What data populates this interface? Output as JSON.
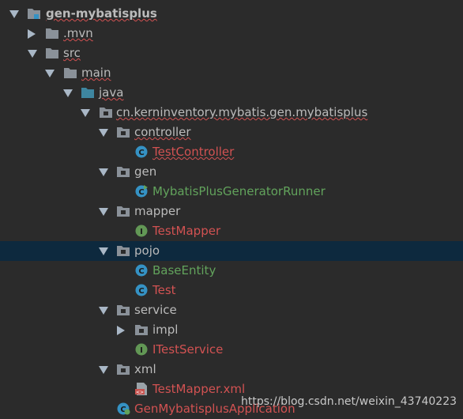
{
  "colors": {
    "background": "#2b2b2b",
    "selected_row": "#0d293e",
    "folder": "#8a9199",
    "source_folder": "#3e86a0",
    "class_icon": "#3592c4",
    "interface_icon": "#629755",
    "error_text": "#d25252",
    "modified_text": "#62a35c"
  },
  "tree": {
    "project": {
      "label": "gen-mybatisplus",
      "icon": "module-folder-icon"
    },
    "mvn": {
      "label": ".mvn",
      "icon": "folder-icon"
    },
    "src": {
      "label": "src",
      "icon": "folder-icon"
    },
    "main": {
      "label": "main",
      "icon": "folder-icon"
    },
    "java": {
      "label": "java",
      "icon": "source-root-icon"
    },
    "package": {
      "label": "cn.kerninventory.mybatis.gen.mybatisplus",
      "icon": "package-icon"
    },
    "controller": {
      "label": "controller",
      "icon": "package-icon"
    },
    "test_controller": {
      "label": "TestController",
      "icon": "class-icon"
    },
    "gen": {
      "label": "gen",
      "icon": "package-icon"
    },
    "runner": {
      "label": "MybatisPlusGeneratorRunner",
      "icon": "runnable-class-icon"
    },
    "mapper": {
      "label": "mapper",
      "icon": "package-icon"
    },
    "test_mapper": {
      "label": "TestMapper",
      "icon": "interface-icon"
    },
    "pojo": {
      "label": "pojo",
      "icon": "package-icon"
    },
    "base_entity": {
      "label": "BaseEntity",
      "icon": "class-icon"
    },
    "test": {
      "label": "Test",
      "icon": "class-icon"
    },
    "service": {
      "label": "service",
      "icon": "package-icon"
    },
    "impl": {
      "label": "impl",
      "icon": "package-icon"
    },
    "itest_service": {
      "label": "ITestService",
      "icon": "interface-icon"
    },
    "xml": {
      "label": "xml",
      "icon": "package-icon"
    },
    "test_mapper_xml": {
      "label": "TestMapper.xml",
      "icon": "xml-file-icon"
    },
    "application": {
      "label": "GenMybatisplusApplication",
      "icon": "spring-boot-class-icon"
    }
  },
  "watermark": "https://blog.csdn.net/weixin_43740223"
}
